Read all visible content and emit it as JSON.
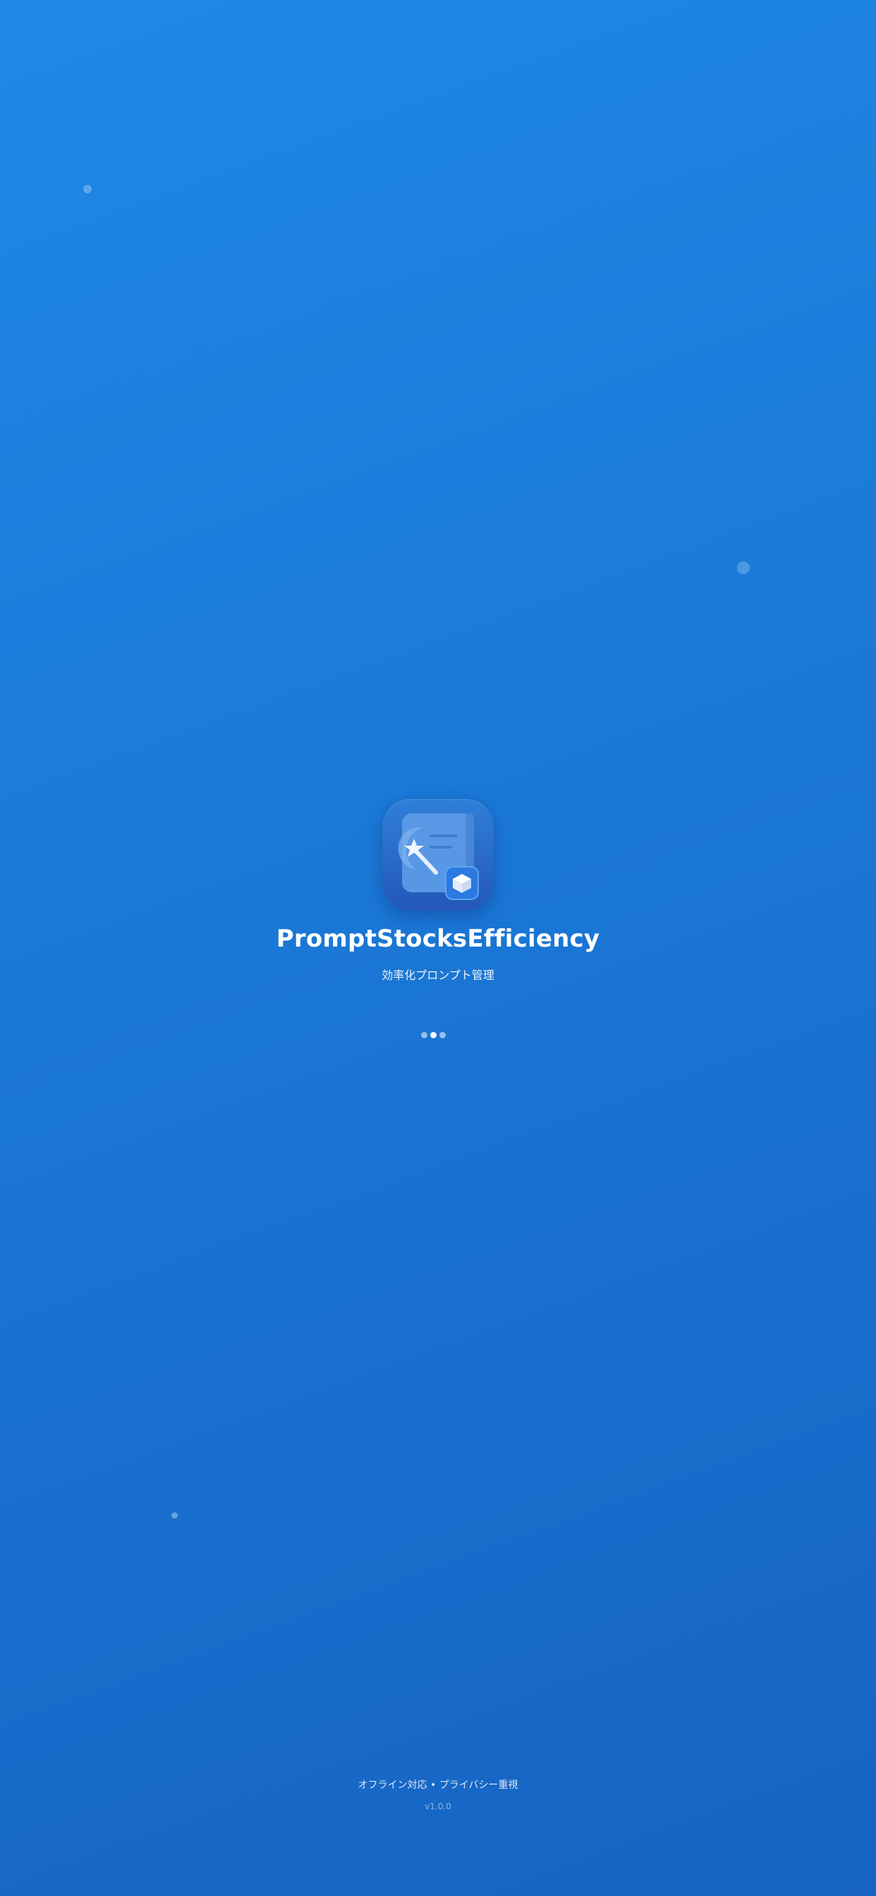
{
  "app": {
    "title": "PromptStocksEfficiency",
    "subtitle": "効率化プロンプト管理",
    "icon_name": "prompt-book-wand-icon",
    "badge_icon_name": "box-icon"
  },
  "loader": {
    "dot_count": 3,
    "active_index": 1
  },
  "footer": {
    "tagline": "オフライン対応 • プライバシー重視",
    "version": "v1.0.0"
  },
  "colors": {
    "background_top": "#1f89e6",
    "background_bottom": "#1663c2",
    "text": "#ffffff"
  }
}
